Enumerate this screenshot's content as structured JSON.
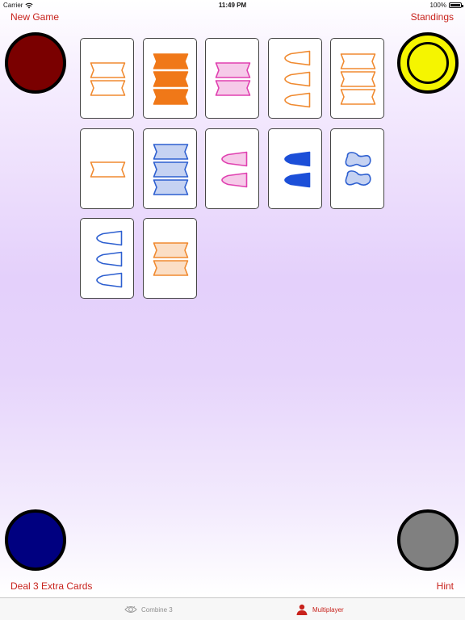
{
  "status_bar": {
    "carrier": "Carrier",
    "time": "11:49 PM",
    "battery": "100%"
  },
  "header": {
    "new_game_label": "New Game",
    "standings_label": "Standings"
  },
  "footer": {
    "deal_label": "Deal 3 Extra Cards",
    "hint_label": "Hint"
  },
  "players": [
    {
      "position": "top-left",
      "color": "#7a0000",
      "ring": false
    },
    {
      "position": "top-right",
      "color": "#f5f500",
      "ring": true
    },
    {
      "position": "bottom-left",
      "color": "#000080",
      "ring": false
    },
    {
      "position": "bottom-right",
      "color": "#808080",
      "ring": false
    }
  ],
  "cards": [
    {
      "shape": "bowtie",
      "color": "#f08a30",
      "fill": "outline",
      "count": 2
    },
    {
      "shape": "bowtie",
      "color": "#f07818",
      "fill": "solid",
      "count": 3
    },
    {
      "shape": "bowtie",
      "color": "#e040b0",
      "fill": "striped",
      "count": 2
    },
    {
      "shape": "wedge",
      "color": "#f08a30",
      "fill": "outline",
      "count": 3
    },
    {
      "shape": "bowtie",
      "color": "#f08a30",
      "fill": "outline",
      "count": 3
    },
    {
      "shape": "bowtie",
      "color": "#f08a30",
      "fill": "outline",
      "count": 1
    },
    {
      "shape": "bowtie",
      "color": "#2d5fd0",
      "fill": "striped",
      "count": 3
    },
    {
      "shape": "wedge",
      "color": "#e040b0",
      "fill": "striped",
      "count": 2
    },
    {
      "shape": "wedge",
      "color": "#1c4fd8",
      "fill": "solid",
      "count": 2
    },
    {
      "shape": "peanut",
      "color": "#2d5fd0",
      "fill": "striped",
      "count": 2
    },
    {
      "shape": "wedge",
      "color": "#2d5fd0",
      "fill": "outline",
      "count": 3
    },
    {
      "shape": "bowtie",
      "color": "#f08a30",
      "fill": "striped",
      "count": 2
    }
  ],
  "tabs": [
    {
      "label": "Combine 3",
      "icon": "eye-icon",
      "selected": false
    },
    {
      "label": "Multiplayer",
      "icon": "person-icon",
      "selected": true
    }
  ],
  "colors": {
    "accent": "#c8231d",
    "tab_inactive": "#8e8e8e"
  }
}
